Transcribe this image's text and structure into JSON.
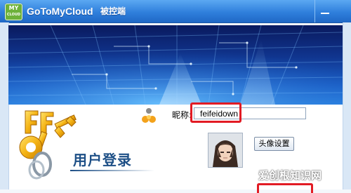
{
  "window": {
    "app_icon_top": "MY",
    "app_icon_bottom": "CLOUD",
    "app_name": "GoToMyCloud",
    "app_subtitle": "被控端"
  },
  "login": {
    "title": "用户登录",
    "nickname_label": "昵称:",
    "nickname_value": "feifeidown",
    "avatar_button": "头像设置"
  },
  "watermark": {
    "text": "爱创根知识网"
  },
  "colors": {
    "titlebar": "#2f7fdc",
    "highlight": "#e21b24",
    "title_text": "#1d4f86"
  },
  "icons": [
    "cloud-app-icon",
    "minimize-icon",
    "user-icon",
    "keys-logo",
    "avatar-image"
  ]
}
